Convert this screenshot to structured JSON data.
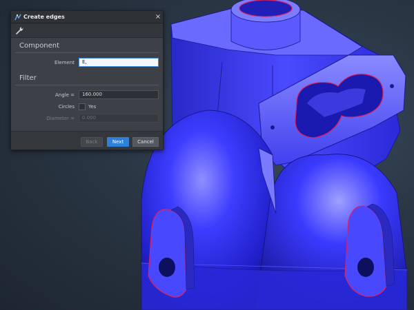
{
  "dialog": {
    "title": "Create edges",
    "close_glyph": "×",
    "toolbar_icon": "wrench-icon",
    "component": {
      "heading": "Component",
      "element_label": "Element",
      "element_value": "E,"
    },
    "filter": {
      "heading": "Filter",
      "angle_label": "Angle =",
      "angle_value": "160.000",
      "circles_label": "Circles",
      "circles_option": "Yes",
      "circles_checked": false,
      "diameter_label": "Diameter =",
      "diameter_value": "0.000"
    },
    "buttons": {
      "back": "Back",
      "next": "Next",
      "cancel": "Cancel"
    }
  },
  "viewport": {
    "model_color": "#2e2ee0",
    "selected_edge_color": "#e0205a",
    "background_color": "#2a3644"
  }
}
